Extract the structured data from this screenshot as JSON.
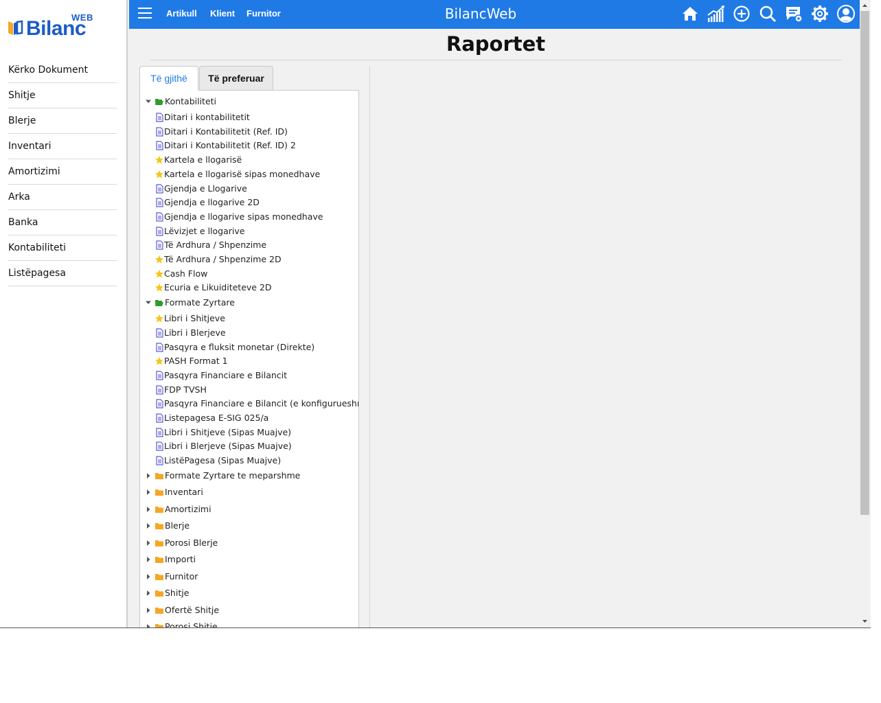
{
  "brand": {
    "web": "WEB",
    "name": "Bilanc"
  },
  "sidebar": {
    "items": [
      {
        "label": "Kërko Dokument"
      },
      {
        "label": "Shitje"
      },
      {
        "label": "Blerje"
      },
      {
        "label": "Inventari"
      },
      {
        "label": "Amortizimi"
      },
      {
        "label": "Arka"
      },
      {
        "label": "Banka"
      },
      {
        "label": "Kontabiliteti"
      },
      {
        "label": "Listëpagesa"
      }
    ]
  },
  "topbar": {
    "links": [
      "Artikull",
      "Klient",
      "Furnitor"
    ],
    "title": "BilancWeb",
    "icons": [
      "home-icon",
      "chart-icon",
      "add-icon",
      "search-icon",
      "notes-settings-icon",
      "settings-icon",
      "user-icon"
    ],
    "color": "#1f7ae6"
  },
  "page": {
    "title": "Raportet"
  },
  "tabs": [
    {
      "label": "Të gjithë",
      "active": true
    },
    {
      "label": "Të preferuar",
      "active": false
    }
  ],
  "tree": {
    "groups": [
      {
        "label": "Kontabiliteti",
        "expanded": true,
        "items": [
          {
            "label": "Ditari i kontabilitetit",
            "icon": "report"
          },
          {
            "label": "Ditari i Kontabilitetit (Ref. ID)",
            "icon": "report"
          },
          {
            "label": "Ditari i Kontabilitetit (Ref. ID) 2",
            "icon": "report"
          },
          {
            "label": "Kartela e llogarisë",
            "icon": "star"
          },
          {
            "label": "Kartela e llogarisë sipas monedhave",
            "icon": "star"
          },
          {
            "label": "Gjendja e Llogarive",
            "icon": "report"
          },
          {
            "label": "Gjendja e llogarive 2D",
            "icon": "report"
          },
          {
            "label": "Gjendja e llogarive sipas monedhave",
            "icon": "report"
          },
          {
            "label": "Lëvizjet e llogarive",
            "icon": "report"
          },
          {
            "label": "Të Ardhura / Shpenzime",
            "icon": "report"
          },
          {
            "label": "Të Ardhura / Shpenzime 2D",
            "icon": "star"
          },
          {
            "label": "Cash Flow",
            "icon": "star"
          },
          {
            "label": "Ecuria e Likuiditeteve 2D",
            "icon": "star"
          }
        ]
      },
      {
        "label": "Formate Zyrtare",
        "expanded": true,
        "items": [
          {
            "label": "Libri i Shitjeve",
            "icon": "star"
          },
          {
            "label": "Libri i Blerjeve",
            "icon": "report"
          },
          {
            "label": "Pasqyra e fluksit monetar (Direkte)",
            "icon": "report"
          },
          {
            "label": "PASH Format 1",
            "icon": "star"
          },
          {
            "label": "Pasqyra Financiare e Bilancit",
            "icon": "report"
          },
          {
            "label": "FDP TVSH",
            "icon": "report"
          },
          {
            "label": "Pasqyra Financiare e Bilancit (e konfigurueshme)",
            "icon": "report"
          },
          {
            "label": "Listepagesa E-SIG 025/a",
            "icon": "report"
          },
          {
            "label": "Libri i Shitjeve (Sipas Muajve)",
            "icon": "report"
          },
          {
            "label": "Libri i Blerjeve (Sipas Muajve)",
            "icon": "report"
          },
          {
            "label": "ListëPagesa (Sipas Muajve)",
            "icon": "report"
          }
        ]
      },
      {
        "label": "Formate Zyrtare te meparshme",
        "expanded": false,
        "items": []
      },
      {
        "label": "Inventari",
        "expanded": false,
        "items": []
      },
      {
        "label": "Amortizimi",
        "expanded": false,
        "items": []
      },
      {
        "label": "Blerje",
        "expanded": false,
        "items": []
      },
      {
        "label": "Porosi Blerje",
        "expanded": false,
        "items": []
      },
      {
        "label": "Importi",
        "expanded": false,
        "items": []
      },
      {
        "label": "Furnitor",
        "expanded": false,
        "items": []
      },
      {
        "label": "Shitje",
        "expanded": false,
        "items": []
      },
      {
        "label": "Ofertë Shitje",
        "expanded": false,
        "items": []
      },
      {
        "label": "Porosi Shitje",
        "expanded": false,
        "items": []
      }
    ]
  },
  "colors": {
    "folder_open": "#2e9b2e",
    "folder": "#f5a623",
    "star": "#f5c518",
    "report": "#5a5ad6",
    "accent": "#1f7ae6"
  }
}
